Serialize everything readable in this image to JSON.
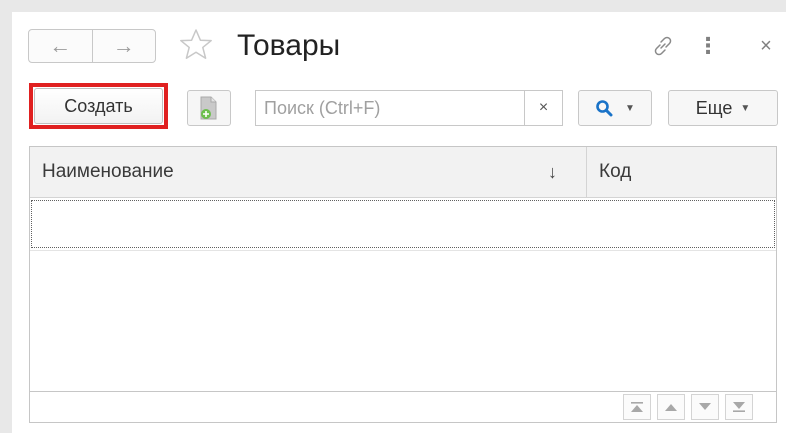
{
  "window": {
    "title": "Товары"
  },
  "nav": {
    "back_icon": "arrow-left-icon",
    "forward_icon": "arrow-right-icon",
    "back_glyph": "←",
    "forward_glyph": "→"
  },
  "title_bar": {
    "favorite_icon": "star-icon",
    "link_icon": "link-icon",
    "menu_icon": "kebab-menu-icon",
    "menu_glyph": "⋮",
    "close_icon": "close-icon",
    "close_glyph": "×"
  },
  "toolbar": {
    "create_label": "Создать",
    "copy_icon": "create-copy-icon",
    "search_placeholder": "Поиск (Ctrl+F)",
    "search_value": "",
    "search_clear_glyph": "×",
    "find_icon": "magnifier-icon",
    "more_label": "Еще",
    "dropdown_glyph": "▼"
  },
  "table": {
    "columns": [
      {
        "label": "Наименование",
        "sort_glyph": "↓"
      },
      {
        "label": "Код"
      }
    ],
    "rows": []
  },
  "scroll": {
    "buttons": [
      "scroll-first-icon",
      "scroll-up-icon",
      "scroll-down-icon",
      "scroll-last-icon"
    ]
  },
  "colors": {
    "highlight": "#e02020",
    "accent": "#1a73c8"
  }
}
